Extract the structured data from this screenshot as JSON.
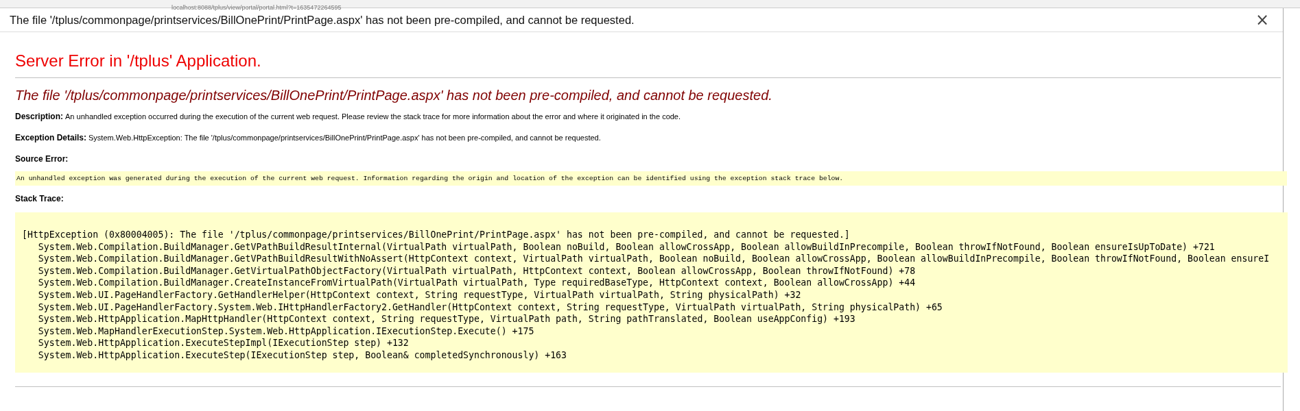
{
  "browser": {
    "url": "localhost:8088/tplus/view/portal/portal.html?t=1635472264595"
  },
  "dialog": {
    "title": "The file '/tplus/commonpage/printservices/BillOnePrint/PrintPage.aspx' has not been pre-compiled, and cannot be requested.",
    "close": "×"
  },
  "page": {
    "heading": "Server Error in '/tplus' Application.",
    "subheading": "The file '/tplus/commonpage/printservices/BillOnePrint/PrintPage.aspx' has not been pre-compiled, and cannot be requested.",
    "fields": [
      {
        "label": "Description:",
        "value": "An unhandled exception occurred during the execution of the current web request. Please review the stack trace for more information about the error and where it originated in the code."
      },
      {
        "label": "Exception Details:",
        "value": "System.Web.HttpException: The file '/tplus/commonpage/printservices/BillOnePrint/PrintPage.aspx' has not been pre-compiled, and cannot be requested."
      }
    ],
    "source_error": {
      "label": "Source Error:",
      "text": "An unhandled exception was generated during the execution of the current web request. Information regarding the origin and location of the exception can be identified using the exception stack trace below."
    },
    "stack_trace": {
      "label": "Stack Trace:",
      "lines": [
        "[HttpException (0x80004005): The file '/tplus/commonpage/printservices/BillOnePrint/PrintPage.aspx' has not been pre-compiled, and cannot be requested.]",
        "   System.Web.Compilation.BuildManager.GetVPathBuildResultInternal(VirtualPath virtualPath, Boolean noBuild, Boolean allowCrossApp, Boolean allowBuildInPrecompile, Boolean throwIfNotFound, Boolean ensureIsUpToDate) +721",
        "   System.Web.Compilation.BuildManager.GetVPathBuildResultWithNoAssert(HttpContext context, VirtualPath virtualPath, Boolean noBuild, Boolean allowCrossApp, Boolean allowBuildInPrecompile, Boolean throwIfNotFound, Boolean ensureI",
        "   System.Web.Compilation.BuildManager.GetVirtualPathObjectFactory(VirtualPath virtualPath, HttpContext context, Boolean allowCrossApp, Boolean throwIfNotFound) +78",
        "   System.Web.Compilation.BuildManager.CreateInstanceFromVirtualPath(VirtualPath virtualPath, Type requiredBaseType, HttpContext context, Boolean allowCrossApp) +44",
        "   System.Web.UI.PageHandlerFactory.GetHandlerHelper(HttpContext context, String requestType, VirtualPath virtualPath, String physicalPath) +32",
        "   System.Web.UI.PageHandlerFactory.System.Web.IHttpHandlerFactory2.GetHandler(HttpContext context, String requestType, VirtualPath virtualPath, String physicalPath) +65",
        "   System.Web.HttpApplication.MapHttpHandler(HttpContext context, String requestType, VirtualPath path, String pathTranslated, Boolean useAppConfig) +193",
        "   System.Web.MapHandlerExecutionStep.System.Web.HttpApplication.IExecutionStep.Execute() +175",
        "   System.Web.HttpApplication.ExecuteStepImpl(IExecutionStep step) +132",
        "   System.Web.HttpApplication.ExecuteStep(IExecutionStep step, Boolean& completedSynchronously) +163"
      ]
    }
  }
}
